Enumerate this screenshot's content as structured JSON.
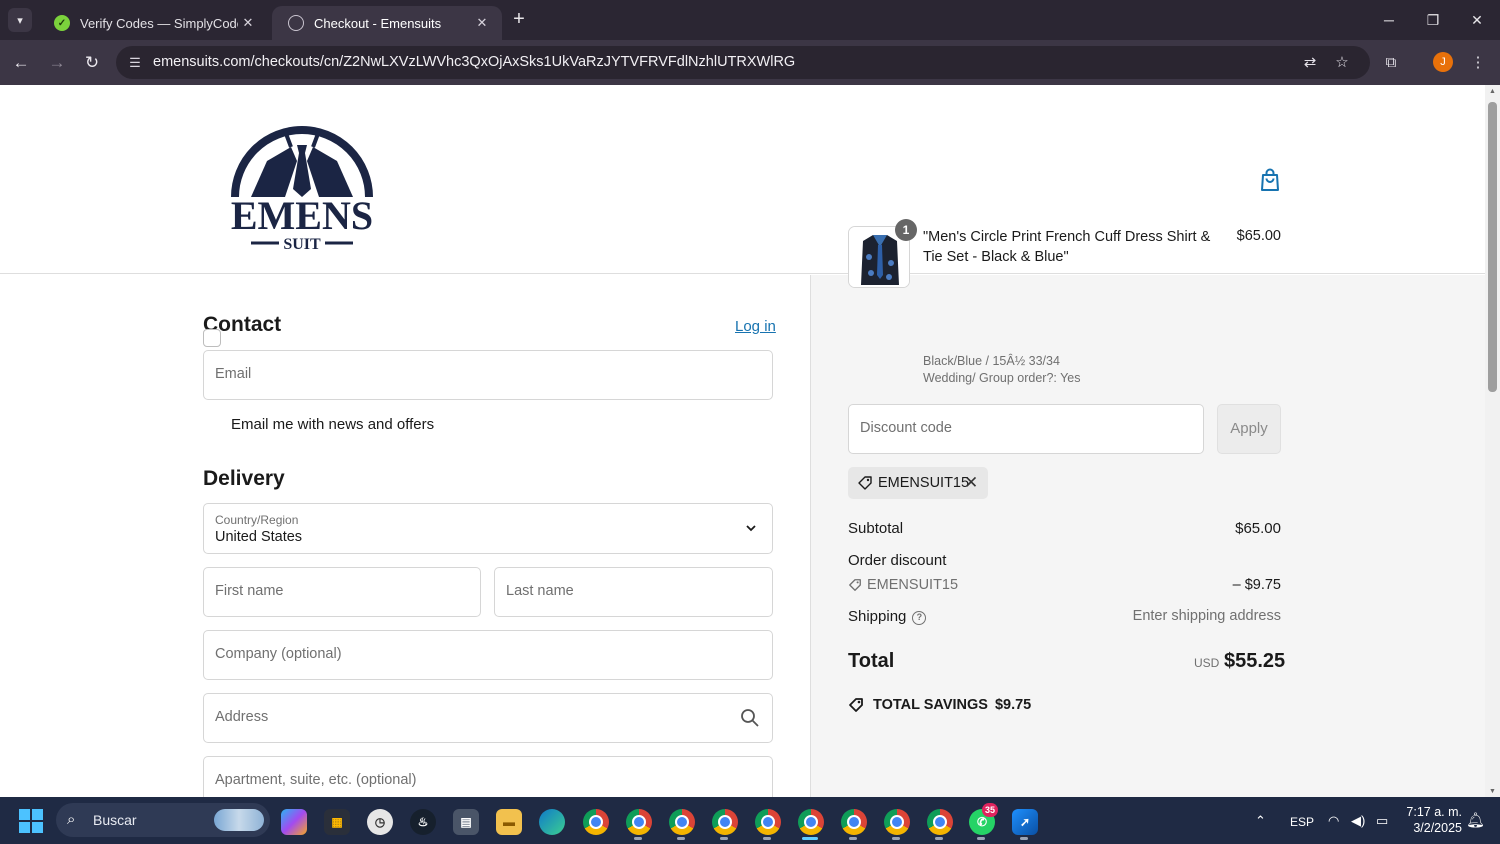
{
  "browser": {
    "tabs": [
      {
        "title": "Verify Codes — SimplyCodes",
        "active": false
      },
      {
        "title": "Checkout - Emensuits",
        "active": true
      }
    ],
    "url": "emensuits.com/checkouts/cn/Z2NwLXVzLWVhc3QxOjAxSks1UkVaRzJYTVFRVFdlNzhlUTRXWlRG",
    "profile_initial": "J"
  },
  "store": {
    "logo_text": "EMENS",
    "logo_subtext": "SUIT"
  },
  "contact": {
    "heading": "Contact",
    "login_link": "Log in",
    "email_placeholder": "Email",
    "newsletter_label": "Email me with news and offers"
  },
  "delivery": {
    "heading": "Delivery",
    "country_label": "Country/Region",
    "country_value": "United States",
    "first_name_placeholder": "First name",
    "last_name_placeholder": "Last name",
    "company_placeholder": "Company (optional)",
    "address_placeholder": "Address",
    "apartment_placeholder": "Apartment, suite, etc. (optional)"
  },
  "order": {
    "quantity": "1",
    "product_name": "\"Men's Circle Print French Cuff Dress Shirt & Tie Set - Black & Blue\"",
    "variant": "Black/Blue / 15Â½ 33/34",
    "option": "Wedding/ Group order?: Yes",
    "price": "$65.00",
    "discount_placeholder": "Discount code",
    "apply_label": "Apply",
    "applied_code": "EMENSUIT15",
    "subtotal_label": "Subtotal",
    "subtotal_value": "$65.00",
    "order_discount_label": "Order discount",
    "discount_code_line": "EMENSUIT15",
    "discount_value": "– $9.75",
    "shipping_label": "Shipping",
    "shipping_value": "Enter shipping address",
    "total_label": "Total",
    "total_currency": "USD",
    "total_value": "$55.25",
    "savings_label": "TOTAL SAVINGS",
    "savings_value": "$9.75"
  },
  "taskbar": {
    "search_text": "Buscar",
    "language": "ESP",
    "time": "7:17 a. m.",
    "date": "3/2/2025",
    "whatsapp_badge": "35"
  },
  "colors": {
    "link": "#1773b0",
    "summary_bg": "#f5f5f5",
    "logo_navy": "#1b2544"
  }
}
